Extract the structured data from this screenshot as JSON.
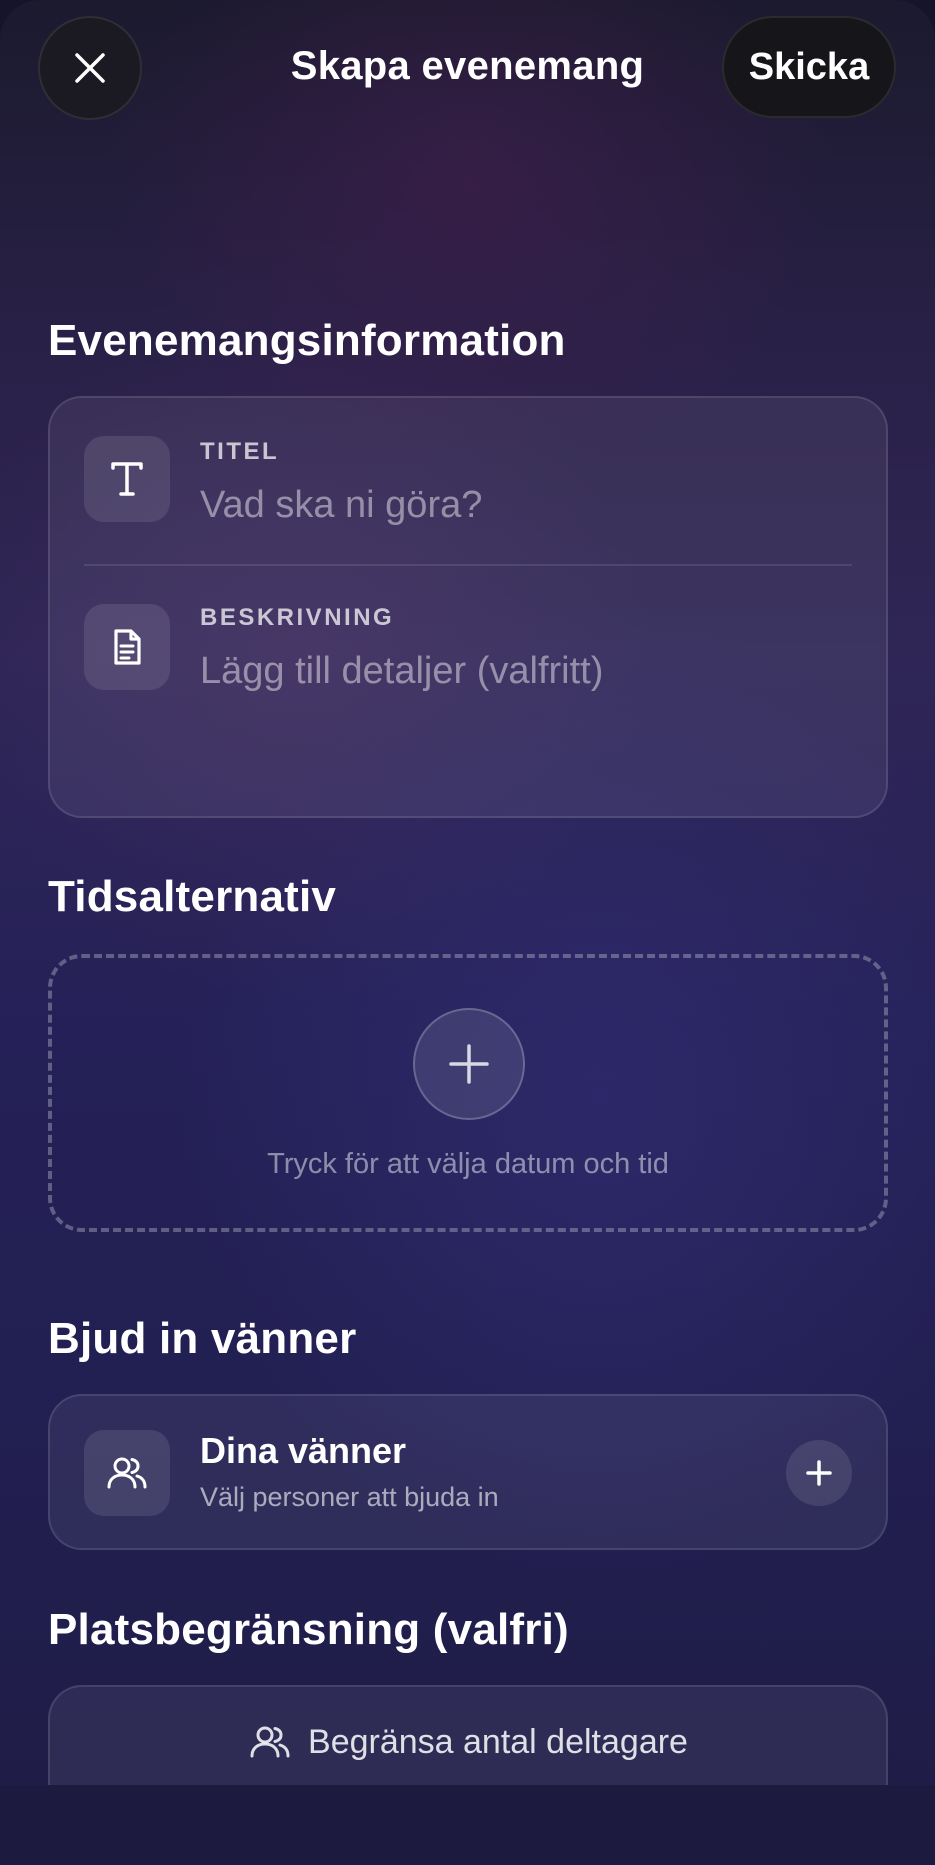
{
  "header": {
    "close_icon": "close-icon",
    "title": "Skapa evenemang",
    "send_label": "Skicka"
  },
  "event_info": {
    "section_title": "Evenemangsinformation",
    "title_field": {
      "icon": "text-format-icon",
      "label": "TITEL",
      "placeholder": "Vad ska ni göra?"
    },
    "description_field": {
      "icon": "document-icon",
      "label": "BESKRIVNING",
      "placeholder": "Lägg till detaljer (valfritt)"
    }
  },
  "time_options": {
    "section_title": "Tidsalternativ",
    "add_icon": "plus-icon",
    "hint": "Tryck för att välja datum och tid"
  },
  "invite": {
    "section_title": "Bjud in vänner",
    "row_icon": "users-icon",
    "row_title": "Dina vänner",
    "row_subtitle": "Välj personer att bjuda in",
    "add_icon": "plus-icon"
  },
  "capacity": {
    "section_title": "Platsbegränsning (valfri)",
    "icon": "users-icon",
    "button_label": "Begränsa antal deltagare"
  },
  "colors": {
    "background_top": "#1b1a2e",
    "background_mid": "#2f2656",
    "background_bottom": "#1f1c45",
    "header_button": "#161519"
  }
}
